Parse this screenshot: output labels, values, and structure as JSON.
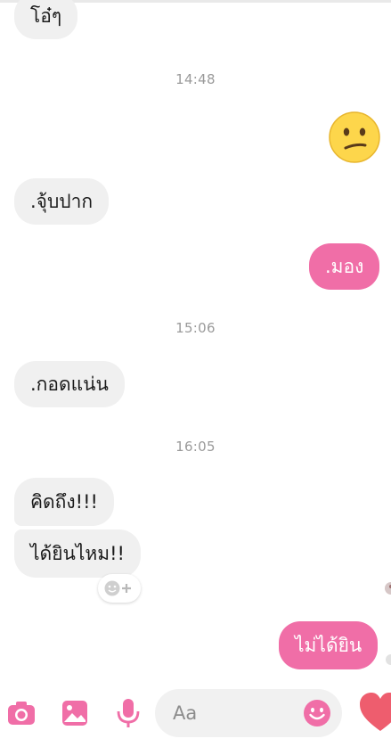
{
  "messages": {
    "m1": "โอ๋ๆ",
    "ts1": "14:48",
    "m3": ".จุ้บปาก",
    "m4": ".มอง",
    "ts2": "15:06",
    "m5": ".กอดแน่น",
    "ts3": "16:05",
    "m6": "คิดถึง!!!",
    "m7": "ได้ยินไหม!!",
    "m8": "ไม่ได้ยิน"
  },
  "composer": {
    "placeholder": "Aa"
  },
  "colors": {
    "accent": "#f06ea7",
    "incoming_bubble": "#f0f0f0"
  },
  "icons": [
    "camera-icon",
    "image-icon",
    "microphone-icon",
    "emoji-icon",
    "heart-icon",
    "add-reaction-icon",
    "confused-emoji"
  ]
}
